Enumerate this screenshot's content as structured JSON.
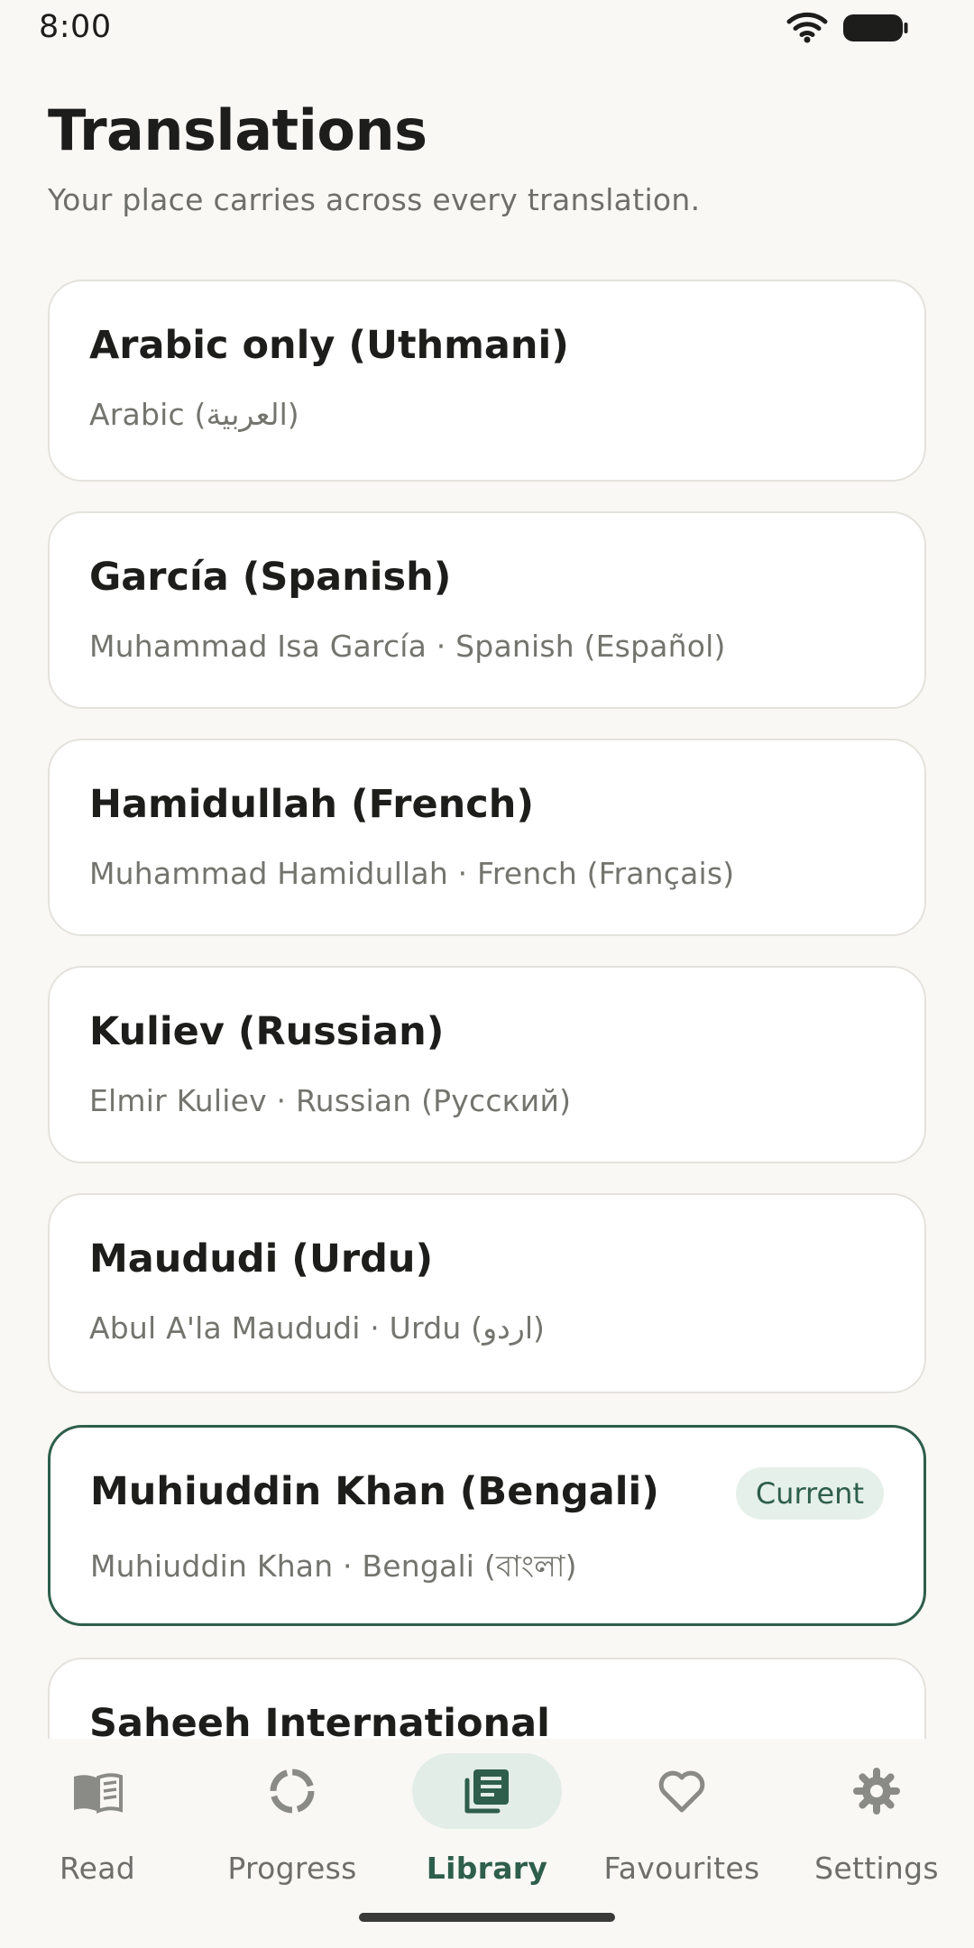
{
  "status_bar": {
    "time": "8:00"
  },
  "header": {
    "title": "Translations",
    "subtitle": "Your place carries across every translation."
  },
  "translations": [
    {
      "title": "Arabic only (Uthmani)",
      "subtitle": "Arabic (العربية)",
      "current": false
    },
    {
      "title": "García (Spanish)",
      "subtitle": "Muhammad Isa García · Spanish (Español)",
      "current": false
    },
    {
      "title": "Hamidullah (French)",
      "subtitle": "Muhammad Hamidullah · French (Français)",
      "current": false
    },
    {
      "title": "Kuliev (Russian)",
      "subtitle": "Elmir Kuliev · Russian (Русский)",
      "current": false
    },
    {
      "title": "Maududi (Urdu)",
      "subtitle": "Abul A'la Maududi · Urdu (اردو)",
      "current": false
    },
    {
      "title": "Muhiuddin Khan (Bengali)",
      "subtitle": "Muhiuddin Khan · Bengali (বাংলা)",
      "current": true,
      "badge": "Current"
    },
    {
      "title": "Saheeh International",
      "subtitle": "",
      "current": false
    }
  ],
  "bottom_nav": [
    {
      "label": "Read",
      "icon": "book-open-icon",
      "active": false
    },
    {
      "label": "Progress",
      "icon": "progress-ring-icon",
      "active": false
    },
    {
      "label": "Library",
      "icon": "library-icon",
      "active": true
    },
    {
      "label": "Favourites",
      "icon": "heart-icon",
      "active": false
    },
    {
      "label": "Settings",
      "icon": "gear-icon",
      "active": false
    }
  ],
  "colors": {
    "background": "#f9f8f5",
    "accent": "#2e5e4c",
    "badge_background": "#e6f0ea",
    "card_border": "#e4e2dc",
    "text_primary": "#1d1d1b",
    "text_secondary": "#74746f"
  }
}
